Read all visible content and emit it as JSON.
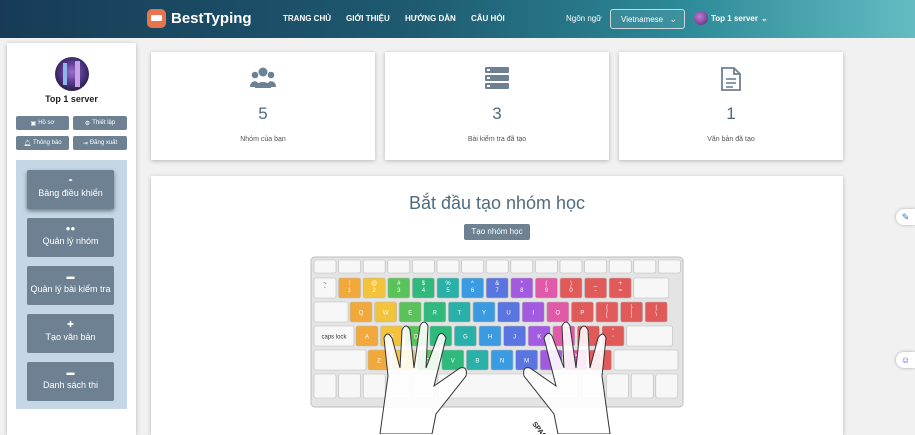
{
  "header": {
    "brand": "BestTyping",
    "nav": [
      "TRANG CHỦ",
      "GIỚI THIỆU",
      "HƯỚNG DẪN",
      "CÂU HỎI"
    ],
    "language_label": "Ngôn ngữ",
    "language_value": "Vietnamese",
    "username": "Top 1 server"
  },
  "sidebar": {
    "username": "Top 1 server",
    "quick_buttons": [
      "Hồ sơ",
      "Thiết lập",
      "Thông báo",
      "Đăng xuất"
    ],
    "items": [
      "Bảng điều khiển",
      "Quản lý nhóm",
      "Quản lý bài kiểm tra",
      "Tạo văn bản",
      "Danh sách thi"
    ]
  },
  "stats": [
    {
      "value": "5",
      "label": "Nhóm của bạn",
      "icon": "users-icon"
    },
    {
      "value": "3",
      "label": "Bài kiểm tra đã tạo",
      "icon": "list-icon"
    },
    {
      "value": "1",
      "label": "Văn bản đã tạo",
      "icon": "document-icon"
    }
  ],
  "main": {
    "title": "Bắt đầu tạo nhóm học",
    "create_button": "Tạo nhóm học",
    "keyboard": {
      "row1": [
        "~\n`",
        "!\n1",
        "@\n2",
        "#\n3",
        "$\n4",
        "%\n5",
        "^\n6",
        "&\n7",
        "*\n8",
        "(\n9",
        ")\n0",
        "_\n-",
        "+\n="
      ],
      "row2": [
        "Q",
        "W",
        "E",
        "R",
        "T",
        "Y",
        "U",
        "I",
        "O",
        "P",
        "{\n[",
        "}\n]",
        "|\n\\"
      ],
      "row3": [
        "A",
        "S",
        "D",
        "F",
        "G",
        "H",
        "J",
        "K",
        "L",
        ":\n;",
        "\"\n'"
      ],
      "row4": [
        "Z",
        "X",
        "C",
        "V",
        "B",
        "N",
        "M",
        "<\n,",
        ">\n.",
        "?\n/"
      ],
      "caps_label": "caps lock",
      "space_label": "SPACE"
    }
  },
  "colors": {
    "accent": "#6d8192",
    "nav_start": "#173b57",
    "nav_end": "#64bcc2",
    "sidebar_panel": "#c5d7e6",
    "value_text": "#4b6a80"
  }
}
